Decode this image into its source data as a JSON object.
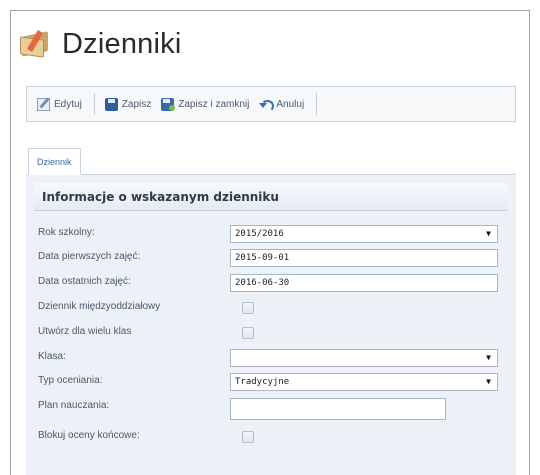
{
  "header": {
    "title": "Dzienniki",
    "icon": "journal-book-icon"
  },
  "toolbar": {
    "edit_label": "Edytuj",
    "save_label": "Zapisz",
    "save_close_label": "Zapisz i zamknij",
    "cancel_label": "Anuluj"
  },
  "tabs": [
    {
      "label": "Dziennik"
    }
  ],
  "section": {
    "title": "Informacje o wskazanym dzienniku"
  },
  "form": {
    "rok_szkolny": {
      "label": "Rok szkolny:",
      "value": "2015/2016"
    },
    "data_pierwszych": {
      "label": "Data pierwszych zajęć:",
      "value": "2015-09-01"
    },
    "data_ostatnich": {
      "label": "Data ostatnich zajęć:",
      "value": "2016-06-30"
    },
    "miedzyoddzialowy": {
      "label": "Dziennik międzyoddziałowy",
      "checked": false
    },
    "wiele_klas": {
      "label": "Utwórz dla wielu klas",
      "checked": false
    },
    "klasa": {
      "label": "Klasa:",
      "value": ""
    },
    "typ_oceniania": {
      "label": "Typ oceniania:",
      "value": "Tradycyjne"
    },
    "plan_nauczania": {
      "label": "Plan nauczania:",
      "value": ""
    },
    "blokuj_oceny": {
      "label": "Blokuj oceny końcowe:",
      "checked": false
    }
  },
  "colors": {
    "accent": "#3c6aa8",
    "panel_bg": "#ecf1f7"
  }
}
